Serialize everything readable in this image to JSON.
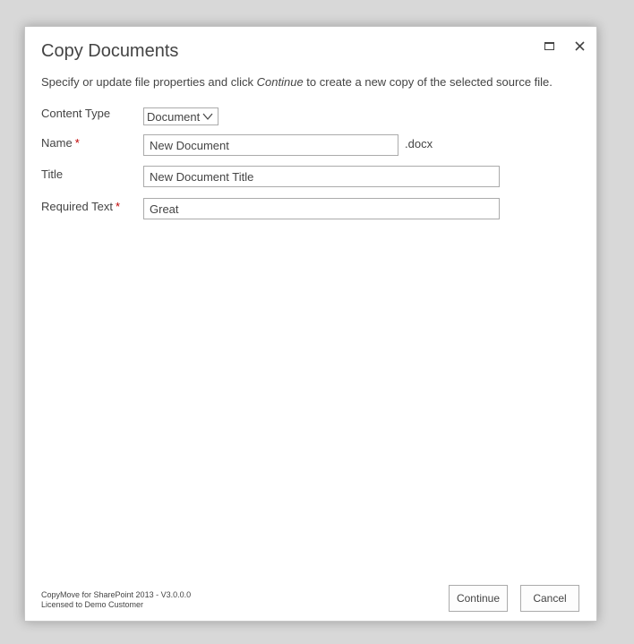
{
  "dialog": {
    "title": "Copy Documents",
    "instructions_prefix": "Specify or update file properties and click ",
    "instructions_emphasis": "Continue",
    "instructions_suffix": " to create a new copy of the selected source file."
  },
  "window_controls": {
    "maximize_icon": "maximize-icon",
    "close_icon": "close-icon"
  },
  "form": {
    "content_type": {
      "label": "Content Type",
      "selected": "Document"
    },
    "name": {
      "label": "Name",
      "required_marker": "*",
      "value": "New Document",
      "extension": ".docx"
    },
    "title": {
      "label": "Title",
      "value": "New Document Title"
    },
    "required_text": {
      "label": "Required Text",
      "required_marker": "*",
      "value": "Great"
    }
  },
  "footer": {
    "product_line": "CopyMove for SharePoint 2013 - V3.0.0.0",
    "license_line": "Licensed to Demo Customer",
    "continue_label": "Continue",
    "cancel_label": "Cancel"
  },
  "colors": {
    "required": "#bf0000",
    "text": "#444444",
    "border": "#ababab",
    "backdrop": "#d8d8d8"
  }
}
